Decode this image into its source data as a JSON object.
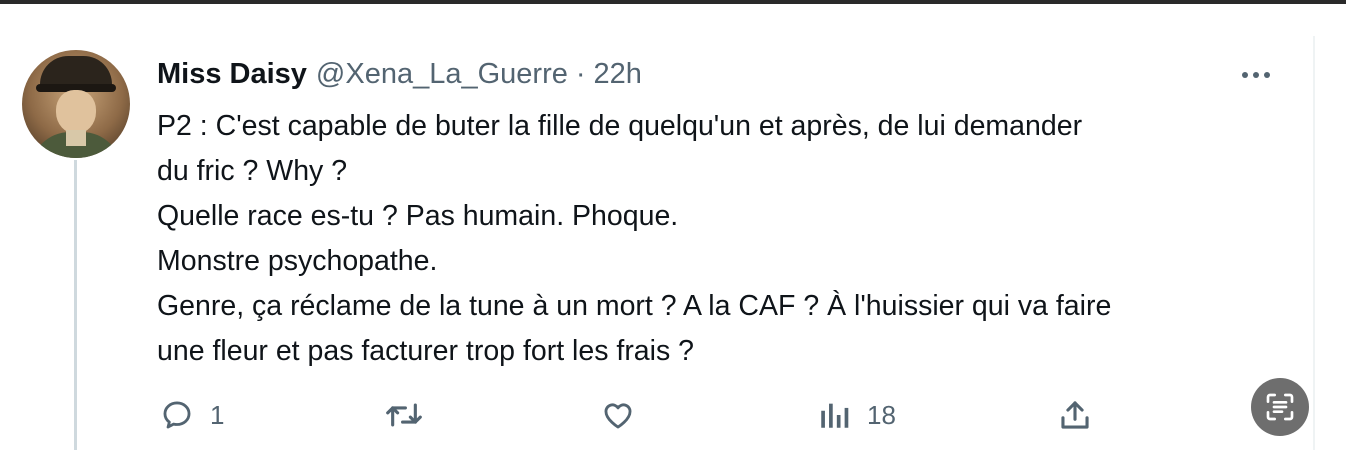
{
  "tweet": {
    "author_name": "Miss Daisy",
    "author_handle": "@Xena_La_Guerre",
    "separator": "·",
    "time": "22h",
    "lines": [
      "P2 : C'est capable de buter la fille de quelqu'un et après, de lui demander",
      "du fric ? Why ?",
      "Quelle race es-tu ? Pas humain. Phoque.",
      "Monstre psychopathe.",
      "Genre, ça réclame de la tune à un mort ? A la CAF ? À l'huissier qui va faire",
      "une fleur et pas facturer trop fort les frais ?"
    ]
  },
  "actions": {
    "reply_count": "1",
    "views_count": "18"
  },
  "icons": {
    "more": "more-horizontal-icon",
    "reply": "reply-icon",
    "retweet": "retweet-icon",
    "like": "heart-icon",
    "views": "bar-chart-icon",
    "share": "share-icon",
    "fab": "text-recognition-icon"
  },
  "colors": {
    "text": "#0f1419",
    "secondary": "#536471",
    "thread_line": "#cfd9de"
  }
}
